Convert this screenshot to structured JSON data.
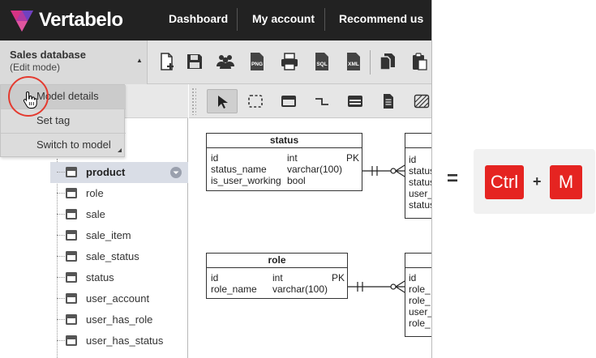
{
  "brand": {
    "name": "Vertabelo"
  },
  "nav": {
    "items": [
      "Dashboard",
      "My account",
      "Recommend us"
    ]
  },
  "model": {
    "name": "Sales database",
    "mode": "(Edit mode)"
  },
  "toolbar": {
    "icons": [
      "new-document-icon",
      "save-icon",
      "users-icon",
      "export-png-icon",
      "print-icon",
      "export-sql-icon",
      "export-xml-icon",
      "copy-icon",
      "paste-icon"
    ]
  },
  "menu": {
    "items": [
      {
        "label": "Model details",
        "hover": true
      },
      {
        "label": "Set tag",
        "hover": false
      },
      {
        "label": "Switch to model",
        "hover": false
      }
    ]
  },
  "tree": {
    "items": [
      {
        "label": "product",
        "selected": true
      },
      {
        "label": "role",
        "selected": false
      },
      {
        "label": "sale",
        "selected": false
      },
      {
        "label": "sale_item",
        "selected": false
      },
      {
        "label": "sale_status",
        "selected": false
      },
      {
        "label": "status",
        "selected": false
      },
      {
        "label": "user_account",
        "selected": false
      },
      {
        "label": "user_has_role",
        "selected": false
      },
      {
        "label": "user_has_status",
        "selected": false
      }
    ]
  },
  "canvas_tools": [
    "select-arrow-icon",
    "marquee-select-icon",
    "add-table-icon",
    "add-reference-icon",
    "add-view-icon",
    "add-note-icon",
    "add-area-icon"
  ],
  "entities": [
    {
      "name": "status",
      "columns": [
        {
          "name": "id",
          "type": "int",
          "key": "PK"
        },
        {
          "name": "status_name",
          "type": "varchar(100)",
          "key": ""
        },
        {
          "name": "is_user_working",
          "type": "bool",
          "key": ""
        }
      ]
    },
    {
      "name": "role",
      "columns": [
        {
          "name": "id",
          "type": "int",
          "key": "PK"
        },
        {
          "name": "role_name",
          "type": "varchar(100)",
          "key": ""
        }
      ]
    }
  ],
  "partial_entities": [
    {
      "columns": [
        "id",
        "status",
        "status",
        "user_",
        "status"
      ]
    },
    {
      "columns": [
        "id",
        "role_",
        "role_",
        "user_",
        "role_"
      ]
    }
  ],
  "shortcut": {
    "equals": "=",
    "keys": [
      "Ctrl",
      "M"
    ],
    "plus": "+"
  },
  "colors": {
    "topbar": "#222222",
    "key_red": "#e52421",
    "highlight": "#e43b30",
    "selected_row": "#d9dde6"
  }
}
